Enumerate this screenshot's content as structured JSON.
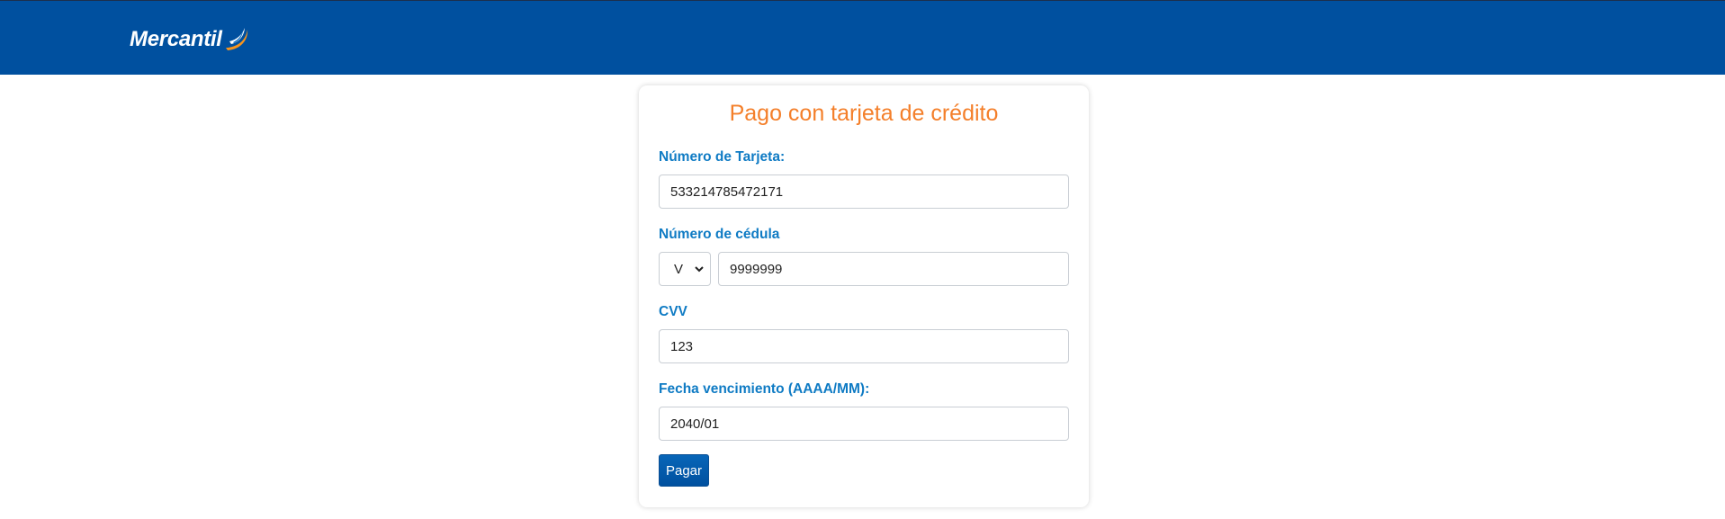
{
  "header": {
    "logo_text": "Mercantil"
  },
  "form": {
    "title": "Pago con tarjeta de crédito",
    "card_number_label": "Número de Tarjeta:",
    "card_number_value": "533214785472171",
    "id_label": "Número de cédula",
    "id_type_value": "V",
    "id_number_value": "9999999",
    "cvv_label": "CVV",
    "cvv_value": "123",
    "expiry_label": "Fecha vencimiento (AAAA/MM):",
    "expiry_value": "2040/01",
    "submit_label": "Pagar"
  },
  "colors": {
    "header_bg": "#00509f",
    "title": "#f47f2a",
    "label": "#0f7bc4",
    "button": "#00509f"
  }
}
